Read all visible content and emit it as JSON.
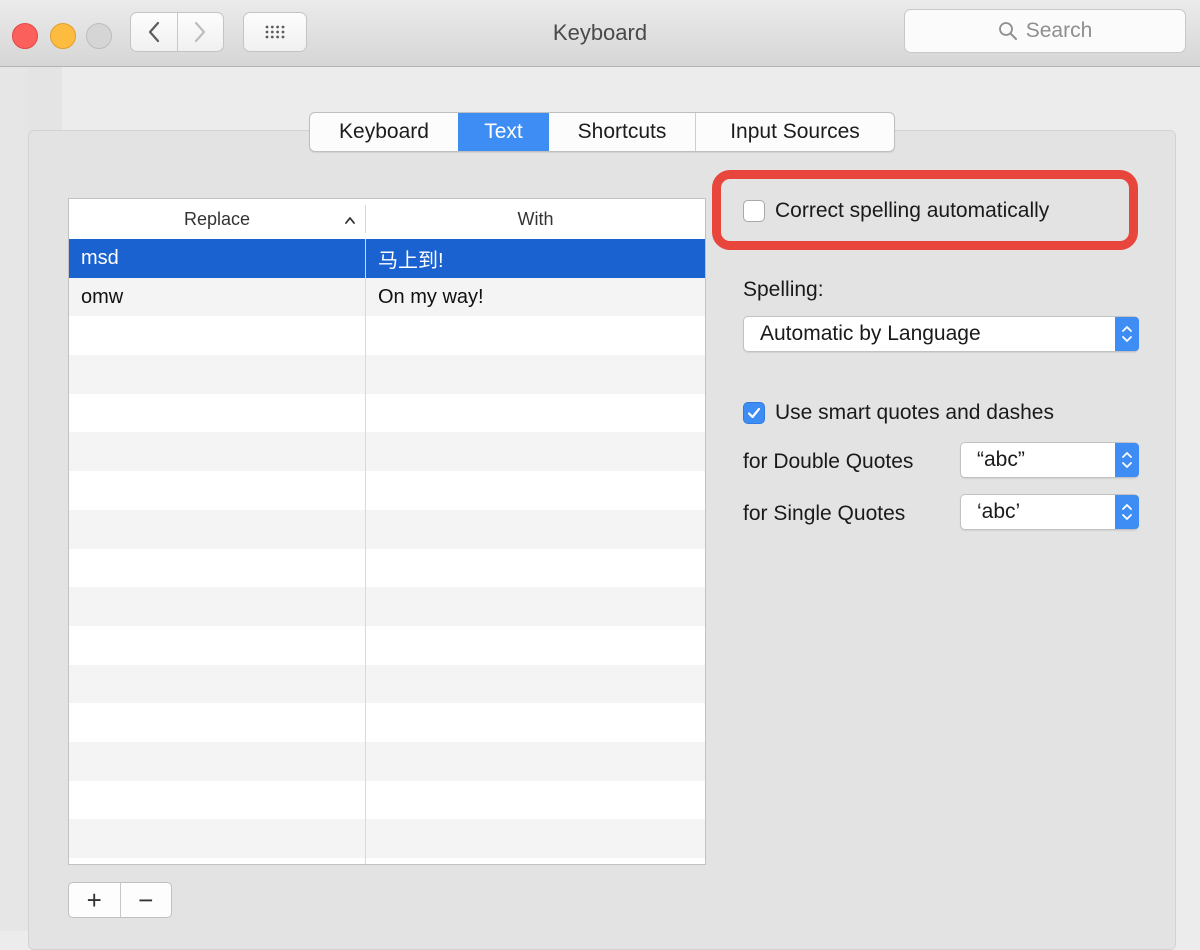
{
  "window": {
    "title": "Keyboard",
    "search_placeholder": "Search"
  },
  "tabs": [
    {
      "label": "Keyboard",
      "selected": false
    },
    {
      "label": "Text",
      "selected": true
    },
    {
      "label": "Shortcuts",
      "selected": false
    },
    {
      "label": "Input Sources",
      "selected": false
    }
  ],
  "table": {
    "columns": [
      "Replace",
      "With"
    ],
    "sort_column": "Replace",
    "rows": [
      {
        "replace": "msd",
        "with": "马上到!",
        "selected": true
      },
      {
        "replace": "omw",
        "with": "On my way!",
        "selected": false
      }
    ]
  },
  "list_buttons": {
    "add": "+",
    "remove": "−"
  },
  "options": {
    "correct_spelling": {
      "label": "Correct spelling automatically",
      "checked": false
    },
    "spelling_label": "Spelling:",
    "spelling_value": "Automatic by Language",
    "smart_quotes": {
      "label": "Use smart quotes and dashes",
      "checked": true
    },
    "double_quotes_label": "for Double Quotes",
    "double_quotes_value": "“abc”",
    "single_quotes_label": "for Single Quotes",
    "single_quotes_value": "‘abc’"
  },
  "colors": {
    "accent": "#3d8df4",
    "selection": "#1a62d0",
    "highlight": "#e8453c",
    "close": "#fc605c",
    "minimize": "#fdbc40",
    "zoom_disabled": "#d5d5d5"
  }
}
